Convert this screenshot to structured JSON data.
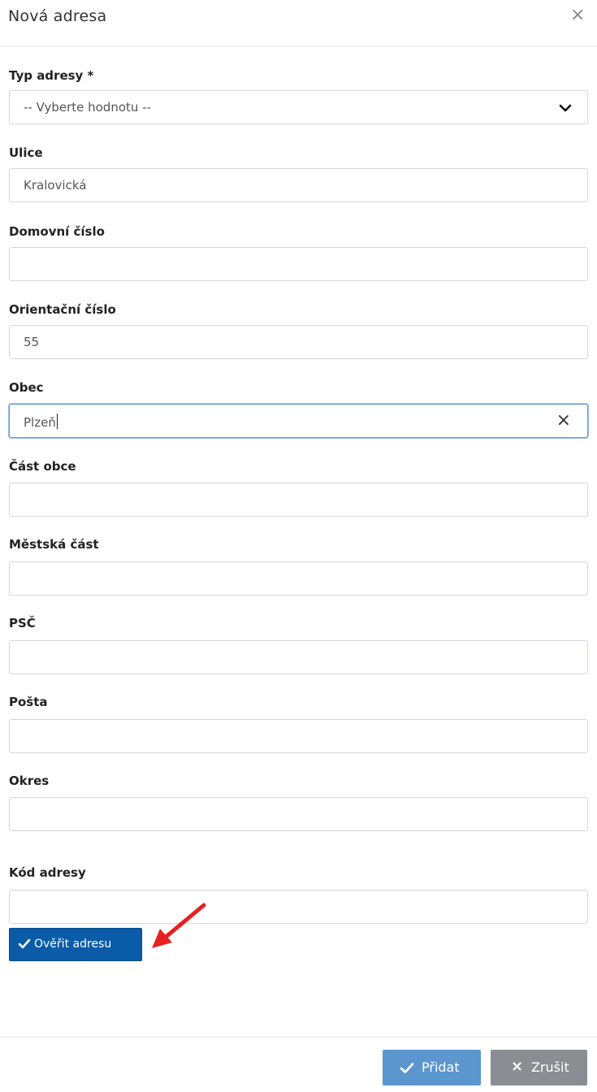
{
  "modal": {
    "title": "Nová adresa",
    "close_glyph": "×"
  },
  "form": {
    "typ_adresy": {
      "label": "Typ adresy *",
      "value": "-- Vyberte hodnotu --"
    },
    "ulice": {
      "label": "Ulice",
      "value": "Kralovická"
    },
    "domovni_cislo": {
      "label": "Domovní číslo",
      "value": ""
    },
    "orientacni_cislo": {
      "label": "Orientační číslo",
      "value": "55"
    },
    "obec": {
      "label": "Obec",
      "value": "Plzeň",
      "clear_glyph": "×"
    },
    "cast_obce": {
      "label": "Část obce",
      "value": ""
    },
    "mestska_cast": {
      "label": "Městská část",
      "value": ""
    },
    "psc": {
      "label": "PSČ",
      "value": ""
    },
    "posta": {
      "label": "Pošta",
      "value": ""
    },
    "okres": {
      "label": "Okres",
      "value": ""
    },
    "kod_adresy": {
      "label": "Kód adresy",
      "value": ""
    }
  },
  "buttons": {
    "verify": "Ověřit adresu",
    "add": "Přidat",
    "cancel": "Zrušit",
    "cancel_glyph": "×"
  },
  "colors": {
    "verify_button": "#0a5ca8",
    "add_button": "#5b96cf",
    "cancel_button": "#8a8d91",
    "annotation_arrow": "#e8201f"
  }
}
